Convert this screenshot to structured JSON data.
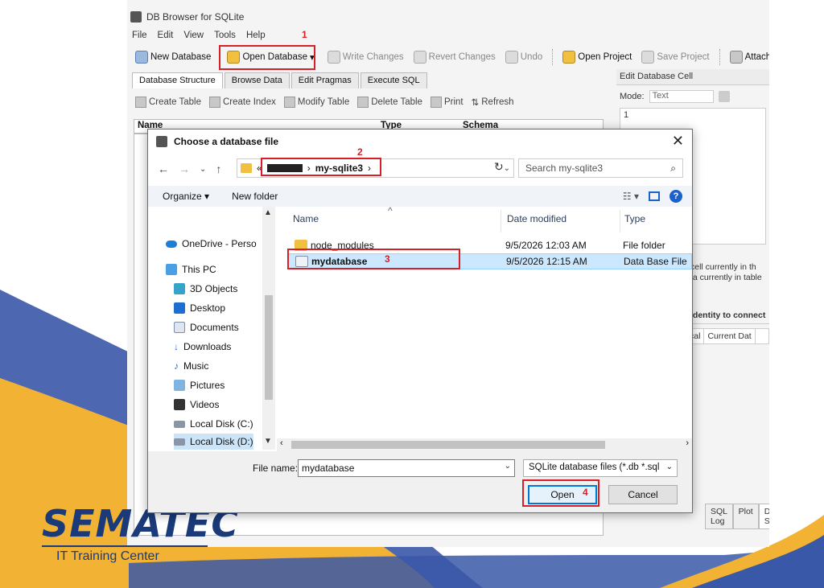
{
  "app": {
    "title": "DB Browser for SQLite",
    "menu": [
      "File",
      "Edit",
      "View",
      "Tools",
      "Help"
    ],
    "toolbar": {
      "new_database": "New Database",
      "open_database": "Open Database",
      "write_changes": "Write Changes",
      "revert_changes": "Revert Changes",
      "undo": "Undo",
      "open_project": "Open Project",
      "save_project": "Save Project",
      "attach": "Attach"
    },
    "tabs": [
      "Database Structure",
      "Browse Data",
      "Edit Pragmas",
      "Execute SQL"
    ],
    "subtoolbar": {
      "create_table": "Create Table",
      "create_index": "Create Index",
      "modify_table": "Modify Table",
      "delete_table": "Delete Table",
      "print": "Print",
      "refresh": "Refresh"
    },
    "tree_columns": [
      "Name",
      "Type",
      "Schema"
    ]
  },
  "dock": {
    "title": "Edit Database Cell",
    "mode_label": "Mode:",
    "mode_value": "Text",
    "cell_value": "1",
    "note_line1": "cell currently in th",
    "note_line2": "ta currently in table",
    "identity": "identity to connect",
    "col_local": "cal",
    "col_current": "Current Dat",
    "bottom_tabs": [
      "SQL Log",
      "Plot",
      "DB Schema"
    ]
  },
  "dialog": {
    "title": "Choose a database file",
    "close": "✕",
    "breadcrumb_root": "«",
    "breadcrumb_folder": "my-sqlite3",
    "search_placeholder": "Search my-sqlite3",
    "organize": "Organize ▾",
    "new_folder": "New folder",
    "nav_items": [
      "OneDrive - Perso",
      "This PC",
      "3D Objects",
      "Desktop",
      "Documents",
      "Downloads",
      "Music",
      "Pictures",
      "Videos",
      "Local Disk (C:)",
      "Local Disk (D:)"
    ],
    "columns": {
      "name": "Name",
      "date": "Date modified",
      "type": "Type"
    },
    "files": [
      {
        "name": "node_modules",
        "date": "9/5/2026 12:03 AM",
        "type": "File folder"
      },
      {
        "name": "mydatabase",
        "date": "9/5/2026 12:15 AM",
        "type": "Data Base File"
      }
    ],
    "file_name_label": "File name:",
    "file_name_value": "mydatabase",
    "filter": "SQLite database files (*.db *.sql",
    "open": "Open",
    "cancel": "Cancel"
  },
  "steps": [
    "1",
    "2",
    "3",
    "4"
  ],
  "logo": {
    "main": "SEMATEC",
    "sub": "IT Training Center"
  },
  "colors": {
    "highlight": "#d61f26",
    "logo": "#1a3a7a",
    "swoosh_blue": "#3a58a8",
    "swoosh_gold": "#f2b233"
  }
}
